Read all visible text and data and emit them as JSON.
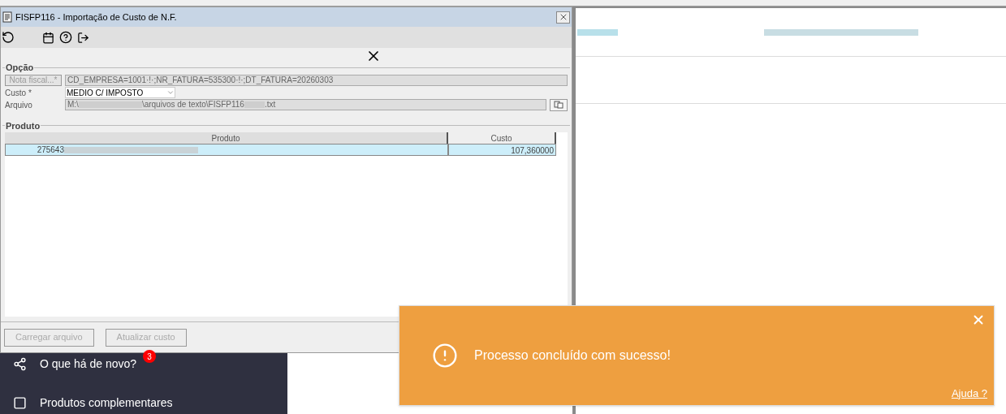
{
  "dialog": {
    "title": "FISFP116 - Importação de Custo de N.F.",
    "opcao": {
      "legend": "Opção",
      "nota_button": "Nota fiscal...*",
      "nota_value": "CD_EMPRESA=1001·!·;NR_FATURA=535300·!·;DT_FATURA=20260303",
      "custo_label": "Custo *",
      "custo_value": "MEDIO C/ IMPOSTO",
      "arquivo_label": "Arquivo",
      "arquivo_parts": [
        "M:\\",
        "\\arquivos de texto\\FISFP116 ",
        ".txt"
      ]
    },
    "produto": {
      "legend": "Produto",
      "columns": [
        "Produto",
        "Custo"
      ],
      "rows": [
        {
          "code": "275643",
          "custo": "107,360000",
          "selected": true
        }
      ]
    },
    "buttons": [
      {
        "label": "Carregar arquivo",
        "disabled": true
      },
      {
        "label": "Atualizar custo",
        "disabled": true
      }
    ]
  },
  "sidebar": {
    "items": [
      {
        "label": "O que há de novo?",
        "kind": "share",
        "badge": "3"
      },
      {
        "label": "Produtos complementares",
        "kind": "checkbox"
      }
    ]
  },
  "toast": {
    "message": "Processo concluído com sucesso!",
    "link": "Ajuda ?"
  }
}
